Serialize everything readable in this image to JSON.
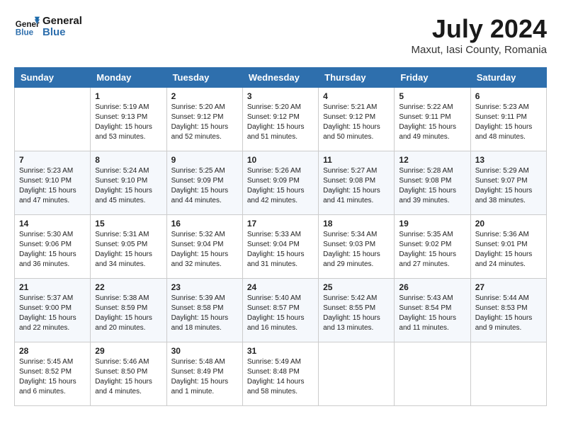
{
  "header": {
    "logo_text_general": "General",
    "logo_text_blue": "Blue",
    "month_title": "July 2024",
    "subtitle": "Maxut, Iasi County, Romania"
  },
  "weekdays": [
    "Sunday",
    "Monday",
    "Tuesday",
    "Wednesday",
    "Thursday",
    "Friday",
    "Saturday"
  ],
  "weeks": [
    [
      {
        "day": "",
        "info": ""
      },
      {
        "day": "1",
        "info": "Sunrise: 5:19 AM\nSunset: 9:13 PM\nDaylight: 15 hours\nand 53 minutes."
      },
      {
        "day": "2",
        "info": "Sunrise: 5:20 AM\nSunset: 9:12 PM\nDaylight: 15 hours\nand 52 minutes."
      },
      {
        "day": "3",
        "info": "Sunrise: 5:20 AM\nSunset: 9:12 PM\nDaylight: 15 hours\nand 51 minutes."
      },
      {
        "day": "4",
        "info": "Sunrise: 5:21 AM\nSunset: 9:12 PM\nDaylight: 15 hours\nand 50 minutes."
      },
      {
        "day": "5",
        "info": "Sunrise: 5:22 AM\nSunset: 9:11 PM\nDaylight: 15 hours\nand 49 minutes."
      },
      {
        "day": "6",
        "info": "Sunrise: 5:23 AM\nSunset: 9:11 PM\nDaylight: 15 hours\nand 48 minutes."
      }
    ],
    [
      {
        "day": "7",
        "info": "Sunrise: 5:23 AM\nSunset: 9:10 PM\nDaylight: 15 hours\nand 47 minutes."
      },
      {
        "day": "8",
        "info": "Sunrise: 5:24 AM\nSunset: 9:10 PM\nDaylight: 15 hours\nand 45 minutes."
      },
      {
        "day": "9",
        "info": "Sunrise: 5:25 AM\nSunset: 9:09 PM\nDaylight: 15 hours\nand 44 minutes."
      },
      {
        "day": "10",
        "info": "Sunrise: 5:26 AM\nSunset: 9:09 PM\nDaylight: 15 hours\nand 42 minutes."
      },
      {
        "day": "11",
        "info": "Sunrise: 5:27 AM\nSunset: 9:08 PM\nDaylight: 15 hours\nand 41 minutes."
      },
      {
        "day": "12",
        "info": "Sunrise: 5:28 AM\nSunset: 9:08 PM\nDaylight: 15 hours\nand 39 minutes."
      },
      {
        "day": "13",
        "info": "Sunrise: 5:29 AM\nSunset: 9:07 PM\nDaylight: 15 hours\nand 38 minutes."
      }
    ],
    [
      {
        "day": "14",
        "info": "Sunrise: 5:30 AM\nSunset: 9:06 PM\nDaylight: 15 hours\nand 36 minutes."
      },
      {
        "day": "15",
        "info": "Sunrise: 5:31 AM\nSunset: 9:05 PM\nDaylight: 15 hours\nand 34 minutes."
      },
      {
        "day": "16",
        "info": "Sunrise: 5:32 AM\nSunset: 9:04 PM\nDaylight: 15 hours\nand 32 minutes."
      },
      {
        "day": "17",
        "info": "Sunrise: 5:33 AM\nSunset: 9:04 PM\nDaylight: 15 hours\nand 31 minutes."
      },
      {
        "day": "18",
        "info": "Sunrise: 5:34 AM\nSunset: 9:03 PM\nDaylight: 15 hours\nand 29 minutes."
      },
      {
        "day": "19",
        "info": "Sunrise: 5:35 AM\nSunset: 9:02 PM\nDaylight: 15 hours\nand 27 minutes."
      },
      {
        "day": "20",
        "info": "Sunrise: 5:36 AM\nSunset: 9:01 PM\nDaylight: 15 hours\nand 24 minutes."
      }
    ],
    [
      {
        "day": "21",
        "info": "Sunrise: 5:37 AM\nSunset: 9:00 PM\nDaylight: 15 hours\nand 22 minutes."
      },
      {
        "day": "22",
        "info": "Sunrise: 5:38 AM\nSunset: 8:59 PM\nDaylight: 15 hours\nand 20 minutes."
      },
      {
        "day": "23",
        "info": "Sunrise: 5:39 AM\nSunset: 8:58 PM\nDaylight: 15 hours\nand 18 minutes."
      },
      {
        "day": "24",
        "info": "Sunrise: 5:40 AM\nSunset: 8:57 PM\nDaylight: 15 hours\nand 16 minutes."
      },
      {
        "day": "25",
        "info": "Sunrise: 5:42 AM\nSunset: 8:55 PM\nDaylight: 15 hours\nand 13 minutes."
      },
      {
        "day": "26",
        "info": "Sunrise: 5:43 AM\nSunset: 8:54 PM\nDaylight: 15 hours\nand 11 minutes."
      },
      {
        "day": "27",
        "info": "Sunrise: 5:44 AM\nSunset: 8:53 PM\nDaylight: 15 hours\nand 9 minutes."
      }
    ],
    [
      {
        "day": "28",
        "info": "Sunrise: 5:45 AM\nSunset: 8:52 PM\nDaylight: 15 hours\nand 6 minutes."
      },
      {
        "day": "29",
        "info": "Sunrise: 5:46 AM\nSunset: 8:50 PM\nDaylight: 15 hours\nand 4 minutes."
      },
      {
        "day": "30",
        "info": "Sunrise: 5:48 AM\nSunset: 8:49 PM\nDaylight: 15 hours\nand 1 minute."
      },
      {
        "day": "31",
        "info": "Sunrise: 5:49 AM\nSunset: 8:48 PM\nDaylight: 14 hours\nand 58 minutes."
      },
      {
        "day": "",
        "info": ""
      },
      {
        "day": "",
        "info": ""
      },
      {
        "day": "",
        "info": ""
      }
    ]
  ]
}
